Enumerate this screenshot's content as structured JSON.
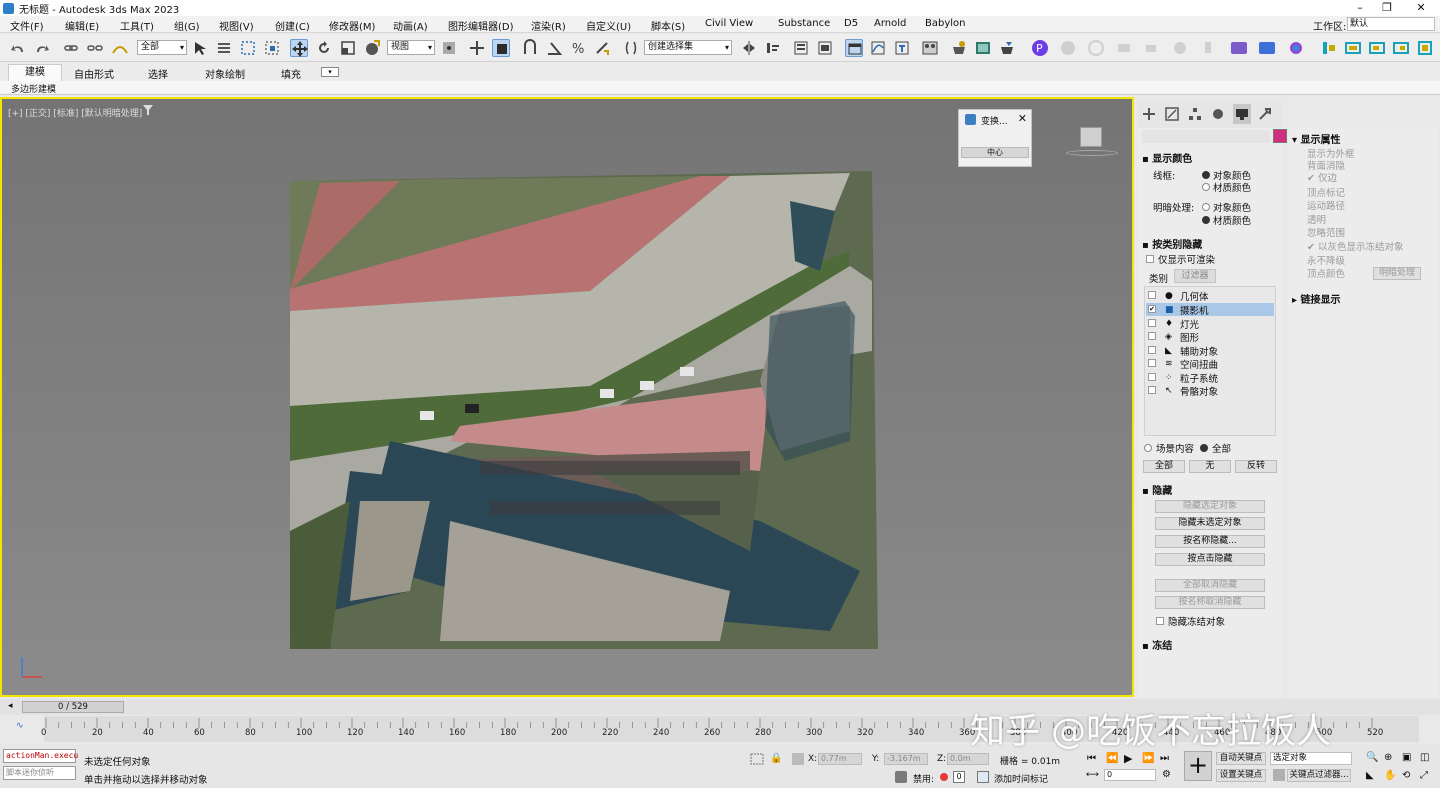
{
  "window": {
    "title": "无标题 - Autodesk 3ds Max 2023",
    "min": "–",
    "max": "❐",
    "close": "✕"
  },
  "menu": [
    "文件(F)",
    "编辑(E)",
    "工具(T)",
    "组(G)",
    "视图(V)",
    "创建(C)",
    "修改器(M)",
    "动画(A)",
    "图形编辑器(D)",
    "渲染(R)",
    "自定义(U)",
    "脚本(S)",
    "Civil View",
    "Substance",
    "D5",
    "Arnold",
    "Babylon"
  ],
  "workspace": {
    "label": "工作区:",
    "value": "默认"
  },
  "toolbar": {
    "selection_filter": "全部",
    "ref_coord": "视图",
    "named_sel": "创建选择集"
  },
  "ribbon": {
    "tabs": [
      "建模",
      "自由形式",
      "选择",
      "对象绘制",
      "填充"
    ],
    "sub": "多边形建模"
  },
  "viewport": {
    "label": "[+] [正交] [标准] [默认明暗处理]"
  },
  "dialog": {
    "title": "变换...",
    "button": "中心"
  },
  "display_panel": {
    "display_color": {
      "title": "显示颜色",
      "wire_label": "线框:",
      "shade_label": "明暗处理:",
      "object_color": "对象颜色",
      "material_color": "材质颜色"
    },
    "hide_by_category": {
      "title": "按类别隐藏",
      "renderable_only": "仅显示可渲染",
      "tab_category": "类别",
      "tab_filter": "过滤器",
      "items": [
        "几何体",
        "摄影机",
        "灯光",
        "图形",
        "辅助对象",
        "空间扭曲",
        "粒子系统",
        "骨骼对象"
      ],
      "scene_content": "场景内容",
      "all_radio": "全部",
      "btn_all": "全部",
      "btn_none": "无",
      "btn_invert": "反转"
    },
    "hide": {
      "title": "隐藏",
      "buttons": [
        "隐藏选定对象",
        "隐藏未选定对象",
        "按名称隐藏...",
        "按点击隐藏",
        "全部取消隐藏",
        "按名称取消隐藏"
      ],
      "frozen": "隐藏冻结对象"
    },
    "freeze": {
      "title": "冻结"
    }
  },
  "props_panel": {
    "title": "显示属性",
    "items": [
      "显示为外框",
      "背面消隐",
      "仅边",
      "顶点标记",
      "运动路径",
      "透明",
      "忽略范围",
      "以灰色显示冻结对象",
      "永不降级",
      "顶点颜色"
    ],
    "shade_btn": "明暗处理",
    "link_title": "链接显示"
  },
  "timeline": {
    "frame": "0 / 529",
    "ticks": [
      "0",
      "20",
      "40",
      "60",
      "80",
      "100",
      "120",
      "140",
      "160",
      "180",
      "200",
      "220",
      "240",
      "260",
      "280",
      "300",
      "320",
      "340",
      "360",
      "380",
      "400",
      "420",
      "440",
      "460",
      "480",
      "500",
      "520"
    ]
  },
  "status": {
    "script": "actionMan.execu",
    "script_placeholder": "脚本迷你侦听",
    "line1": "未选定任何对象",
    "line2": "单击并拖动以选择并移动对象",
    "x_label": "X:",
    "x_val": "0.77m",
    "y_label": "Y:",
    "y_val": "-3.167m",
    "z_label": "Z:",
    "z_val": "0.0m",
    "grid": "栅格 = 0.01m",
    "disable": "禁用:",
    "add_key": "添加时间标记",
    "auto_key": "自动关键点",
    "set_key": "设置关键点",
    "sel_obj": "选定对象",
    "key_filter": "关键点过滤器...",
    "frame_field": "0"
  },
  "watermark": "知乎 @吃饭不忘拉饭人",
  "colors": {
    "viewport_border": "#f2e600",
    "swatch": "#d0307c",
    "selection": "#a9c7e6"
  }
}
